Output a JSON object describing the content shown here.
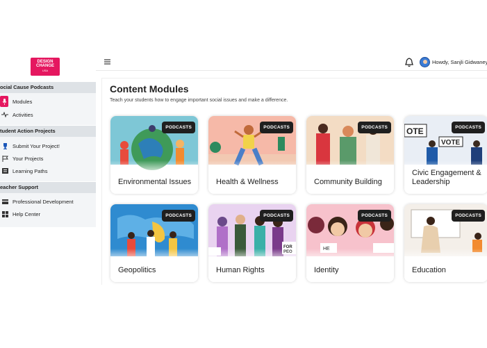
{
  "logo": {
    "line1": "DESIGN",
    "line2": "CHANGE",
    "line3": "USA"
  },
  "sidebar": {
    "sections": [
      {
        "title": "ocial Cause Podcasts",
        "items": [
          {
            "label": "Modules",
            "icon": "mic-icon"
          },
          {
            "label": "Activities",
            "icon": "activity-icon"
          }
        ]
      },
      {
        "title": "tudent Action Projects",
        "items": [
          {
            "label": "Submit Your Project!",
            "icon": "trophy-icon"
          },
          {
            "label": "Your Projects",
            "icon": "flag-icon"
          },
          {
            "label": "Learning Paths",
            "icon": "list-icon"
          }
        ]
      },
      {
        "title": "eacher Support",
        "items": [
          {
            "label": "Professional Development",
            "icon": "card-icon"
          },
          {
            "label": "Help Center",
            "icon": "grid-icon"
          }
        ]
      }
    ]
  },
  "header": {
    "menu_icon": "hamburger-icon",
    "greeting": "Howdy, Sanjli Gidwaney"
  },
  "main": {
    "title": "Content Modules",
    "subtitle": "Teach your students how to engage important social issues and make a difference.",
    "badge": "PODCASTS",
    "cards": [
      {
        "label": "Environmental Issues",
        "color": "#7ec7d6"
      },
      {
        "label": "Health & Wellness",
        "color": "#f6b9a8"
      },
      {
        "label": "Community Building",
        "color": "#f3dcc4"
      },
      {
        "label": "Civic Engagement & Leadership",
        "color": "#e9eef5"
      },
      {
        "label": "Geopolitics",
        "color": "#2f8bd0"
      },
      {
        "label": "Human Rights",
        "color": "#e9d3f0"
      },
      {
        "label": "Identity",
        "color": "#f7c2cc"
      },
      {
        "label": "Education",
        "color": "#f4efe9"
      }
    ]
  },
  "colors": {
    "brand": "#e5175f",
    "badge": "#1f1f1f"
  }
}
